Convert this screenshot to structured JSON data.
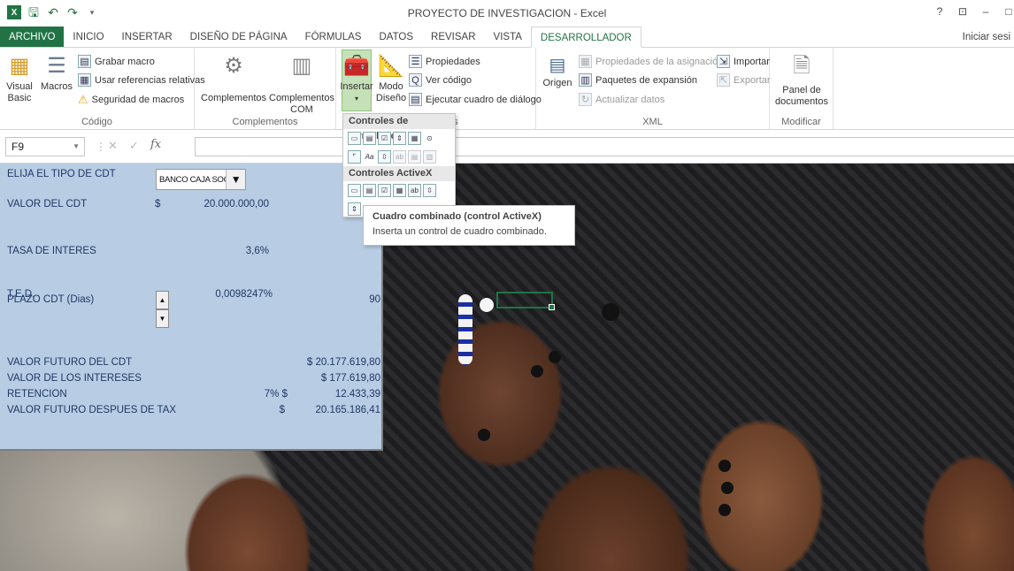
{
  "window": {
    "title": "PROYECTO DE INVESTIGACION - Excel",
    "help": "?",
    "restore": "⊡",
    "minimize": "–",
    "maximize": "□"
  },
  "tabs": [
    "ARCHIVO",
    "INICIO",
    "INSERTAR",
    "DISEÑO DE PÁGINA",
    "FÓRMULAS",
    "DATOS",
    "REVISAR",
    "VISTA",
    "DESARROLLADOR"
  ],
  "active_tab": "DESARROLLADOR",
  "signin": "Iniciar sesi",
  "ribbon": {
    "codigo": {
      "label": "Código",
      "visual_basic": "Visual\nBasic",
      "macros": "Macros",
      "grabar_macro": "Grabar macro",
      "usar_referencias": "Usar referencias relativas",
      "seguridad": "Seguridad de macros"
    },
    "complementos": {
      "label": "Complementos",
      "complementos": "Complementos",
      "complementos_com": "Complementos\nCOM"
    },
    "controles": {
      "label_tail": "s",
      "insertar": "Insertar",
      "modo_diseno": "Modo\nDiseño",
      "propiedades": "Propiedades",
      "ver_codigo": "Ver código",
      "ejecutar_cuadro": "Ejecutar cuadro de diálogo"
    },
    "xml": {
      "label": "XML",
      "origen": "Origen",
      "propiedades_asignacion": "Propiedades de la asignación",
      "paquetes_expansion": "Paquetes de expansión",
      "actualizar_datos": "Actualizar datos",
      "importar": "Importar",
      "exportar": "Exportar"
    },
    "modificar": {
      "label": "Modificar",
      "panel_documentos": "Panel de\ndocumentos"
    }
  },
  "formula_bar": {
    "name_box": "F9",
    "fx": "fx",
    "value": ""
  },
  "dropdown": {
    "form_controls_header": "Controles de formulario",
    "activex_header": "Controles ActiveX"
  },
  "tooltip": {
    "title": "Cuadro combinado (control ActiveX)",
    "description": "Inserta un control de cuadro combinado."
  },
  "cdt": {
    "tipo_label": "ELIJA EL TIPO DE CDT",
    "combo_value": "BANCO CAJA SOCIAL",
    "valor_label": "VALOR DEL CDT",
    "valor_currency": "$",
    "valor_value": "20.000.000,00",
    "tasa_label": "TASA DE INTERES",
    "tasa_value": "3,6%",
    "ted_label": "T.E.D.",
    "ted_value": "0,0098247%",
    "plazo_label": "PLAZO CDT (Dias)",
    "plazo_value": "90",
    "futuro_label": "VALOR FUTURO DEL CDT",
    "futuro_value": "$ 20.177.619,80",
    "intereses_label": "VALOR DE LOS INTERESES",
    "intereses_value": "$ 177.619,80",
    "retencion_label": "RETENCION",
    "retencion_pct": "7% $",
    "retencion_value": "12.433,39",
    "despues_label": "VALOR FUTURO DESPUES DE TAX",
    "despues_currency": "$",
    "despues_value": "20.165.186,41"
  }
}
